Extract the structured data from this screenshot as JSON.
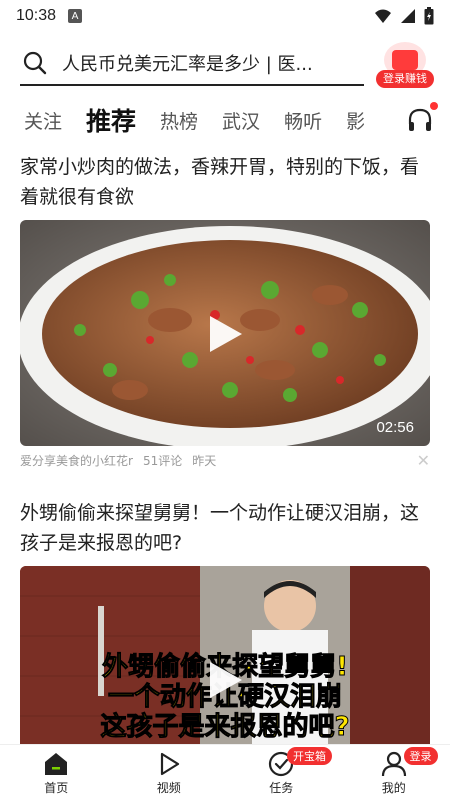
{
  "status_bar": {
    "time": "10:38",
    "notification_letter": "A"
  },
  "search": {
    "query": "人民币兑美元汇率是多少 | 医..."
  },
  "login_reward": {
    "label": "登录赚钱"
  },
  "tabs": [
    {
      "label": "关注",
      "active": false
    },
    {
      "label": "推荐",
      "active": true
    },
    {
      "label": "热榜",
      "active": false
    },
    {
      "label": "武汉",
      "active": false
    },
    {
      "label": "畅听",
      "active": false
    },
    {
      "label": "影",
      "active": false
    }
  ],
  "articles": [
    {
      "title": "家常小炒肉的做法，香辣开胃，特别的下饭，看着就很有食欲",
      "duration": "02:56",
      "source": "爱分享美食的小红花r",
      "comments": "51评论",
      "time": "昨天"
    },
    {
      "title": "外甥偷偷来探望舅舅！一个动作让硬汉泪崩，这孩子是来报恩的吧?",
      "caption_lines": [
        "外甥偷偷来探望舅舅!",
        "一个动作让硬汉泪崩",
        "这孩子是来报恩的吧?"
      ]
    }
  ],
  "tabbar": [
    {
      "label": "首页",
      "badge": ""
    },
    {
      "label": "视频",
      "badge": ""
    },
    {
      "label": "任务",
      "badge": "开宝箱"
    },
    {
      "label": "我的",
      "badge": "登录"
    }
  ],
  "colors": {
    "accent_red": "#f23030",
    "text": "#222222",
    "muted": "#999999"
  }
}
